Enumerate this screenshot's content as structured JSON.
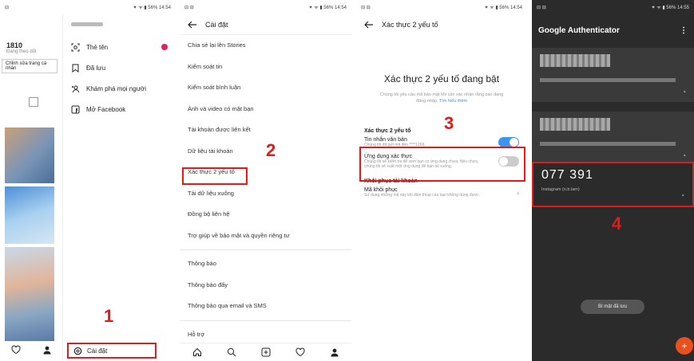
{
  "panel1": {
    "status": {
      "left": "⊟",
      "right": "✦ ᯤ ▮ 56% 14:54"
    },
    "stats": {
      "count": "1810",
      "count_label": "Đang theo dõi",
      "edit_label": "Chỉnh sửa trang cá nhân"
    },
    "menu": [
      {
        "label": "Thẻ tên",
        "icon": "qr-scan-icon",
        "badge": true
      },
      {
        "label": "Đã lưu",
        "icon": "bookmark-icon",
        "badge": false
      },
      {
        "label": "Khám phá mọi người",
        "icon": "add-person-icon",
        "badge": false
      },
      {
        "label": "Mở Facebook",
        "icon": "facebook-icon",
        "badge": false
      }
    ],
    "settings_label": "Cài đặt",
    "step": "1"
  },
  "panel2": {
    "status": {
      "left": "⊟ ⊟",
      "right": "✦ ᯤ ▮ 56% 14:54"
    },
    "title": "Cài đặt",
    "items": [
      "Chia sẻ lại lên Stories",
      "Kiểm soát tin",
      "Kiểm soát bình luận",
      "Ảnh và video có mặt bạn",
      "Tài khoản được liên kết",
      "Dữ liệu tài khoản",
      "Xác thực 2 yếu tố",
      "Tải dữ liệu xuống",
      "Đồng bộ liên hệ",
      "Trợ giúp về bảo mật và quyền riêng tư"
    ],
    "items2": [
      "Thông báo",
      "Thông báo đẩy",
      "Thông báo qua email và SMS"
    ],
    "help": "Hỗ trợ",
    "step": "2"
  },
  "panel3": {
    "status": {
      "left": "⊟ ⊟",
      "right": "✦ ᯤ ▮ 56% 14:54"
    },
    "title": "Xác thực 2 yếu tố",
    "heading": "Xác thực 2 yếu tố đang bật",
    "desc": "Chúng tôi yêu cầu mã bảo mật khi cần xác nhận rằng bạn đang đăng nhập.",
    "learn_more": "Tìm hiểu thêm",
    "section": "Xác thực 2 yếu tố",
    "sms": {
      "label": "Tin nhắn văn bản",
      "sub": "Chúng tôi đã gửi mã đến ****1266."
    },
    "app": {
      "label": "Ứng dụng xác thực",
      "sub": "Chúng tôi sẽ kiểm tra để xem bạn có ứng dụng chưa. Nếu chưa, chúng tôi sẽ xuất một ứng dụng để bạn tải xuống."
    },
    "recovery_section": "Khôi phục tài khoản",
    "recovery": {
      "label": "Mã khôi phục",
      "sub": "Sử dụng những mã này khi điện thoại của bạn không dùng được."
    },
    "step": "3"
  },
  "panel4": {
    "status": {
      "left": "⊟ ⊟",
      "right": "✦ ᯤ ▮ 56% 14:55"
    },
    "title": "Google Authenticator",
    "code": "077 391",
    "code_sub": "Instagram (n.b.lam)",
    "pill": "Bí mật đã lưu",
    "fab": "+",
    "step": "4"
  },
  "colors": {
    "highlight": "#e01b1b",
    "instagram_blue": "#3897f0",
    "fab": "#e8501f"
  }
}
